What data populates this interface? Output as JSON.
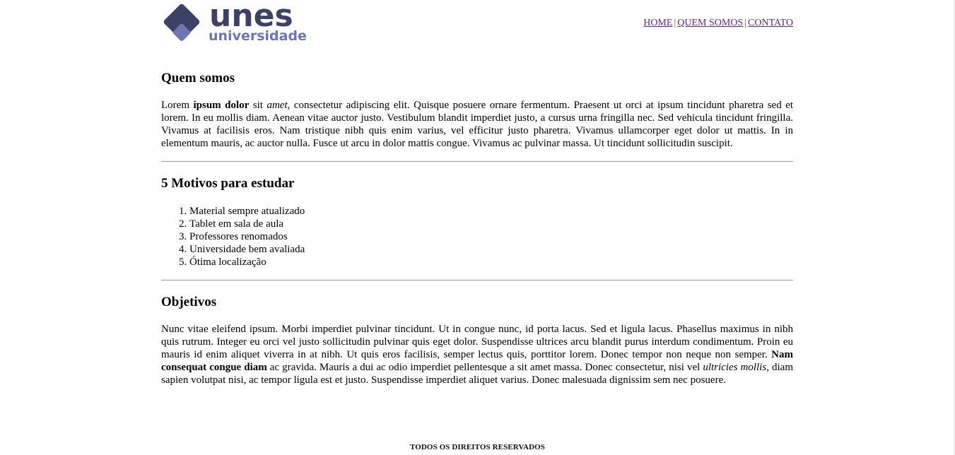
{
  "logo": {
    "word": "unes",
    "subword": "universidade",
    "color_primary": "#3d4166",
    "color_secondary": "#6f75b0"
  },
  "nav": {
    "items": [
      "HOME",
      "QUEM SOMOS",
      "CONTATO"
    ],
    "separator": "|",
    "link_color": "#5a2a82"
  },
  "sections": {
    "quem_somos": {
      "title": "Quem somos",
      "p_lorem": "Lorem ",
      "p_bold": "ipsum dolor",
      "p_sit": " sit ",
      "p_italic": "amet",
      "p_rest": ", consectetur adipiscing elit. Quisque posuere ornare fermentum. Praesent ut orci at ipsum tincidunt pharetra sed et lorem. In eu mollis diam. Aenean vitae auctor justo. Vestibulum blandit imperdiet justo, a cursus urna fringilla nec. Sed vehicula tincidunt fringilla. Vivamus at facilisis eros. Nam tristique nibh quis enim varius, vel efficitur justo pharetra. Vivamus ullamcorper eget dolor ut mattis. In in elementum mauris, ac auctor nulla. Fusce ut arcu in dolor mattis congue. Vivamus ac pulvinar massa. Ut tincidunt sollicitudin suscipit."
    },
    "motivos": {
      "title": "5 Motivos para estudar",
      "items": [
        "Material sempre atualizado",
        "Tablet em sala de aula",
        "Professores renomados",
        "Universidade bem avaliada",
        "Ótima localização"
      ]
    },
    "objetivos": {
      "title": "Objetivos",
      "p1": "Nunc vitae eleifend ipsum. Morbi imperdiet pulvinar tincidunt. Ut in congue nunc, id porta lacus. Sed et ligula lacus. Phasellus maximus in nibh quis rutrum. Integer eu orci vel justo sollicitudin pulvinar quis eget dolor. Suspendisse ultrices arcu blandit purus interdum condimentum. Proin eu mauris id enim aliquet viverra in at nibh. Ut quis eros facilisis, semper lectus quis, porttitor lorem. Donec tempor non neque non semper. ",
      "bold": "Nam consequat congue diam",
      "p2": " ac gravida. Mauris a dui ac odio imperdiet pellentesque a sit amet massa. Donec consectetur, nisi vel ",
      "italic": "ultricies mollis",
      "p3": ", diam sapien volutpat nisi, ac tempor ligula est et justo. Suspendisse imperdiet aliquet varius. Donec malesuada dignissim sem nec posuere."
    }
  },
  "footer": {
    "text": "TODOS OS DIREITOS RESERVADOS"
  }
}
